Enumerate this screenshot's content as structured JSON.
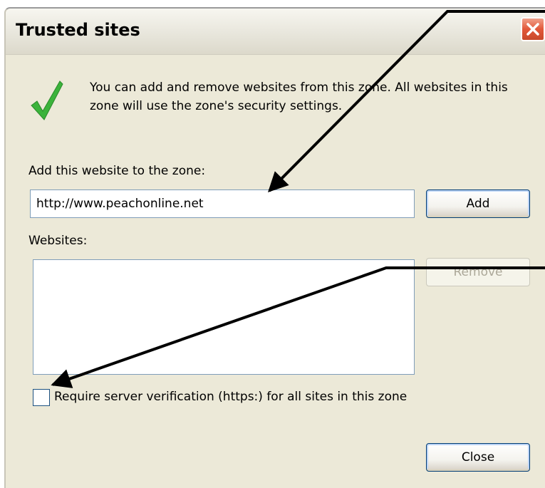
{
  "window": {
    "title": "Trusted sites",
    "close_symbol": "✕"
  },
  "info": {
    "icon": "check-icon",
    "text": "You can add and remove websites from this zone. All websites in this zone will use the zone's security settings."
  },
  "add_section": {
    "label": "Add this website to the zone:",
    "input_value": "http://www.peachonline.net",
    "add_button": "Add"
  },
  "websites_section": {
    "label": "Websites:",
    "items": [],
    "remove_button": "Remove"
  },
  "verification": {
    "label": "Require server verification (https:) for all sites in this zone",
    "checked": false
  },
  "footer": {
    "close_button": "Close"
  },
  "colors": {
    "dialog_bg": "#ece9d8",
    "close_red": "#e2583a",
    "check_green": "#3bb33b",
    "input_border": "#7f9db9"
  }
}
